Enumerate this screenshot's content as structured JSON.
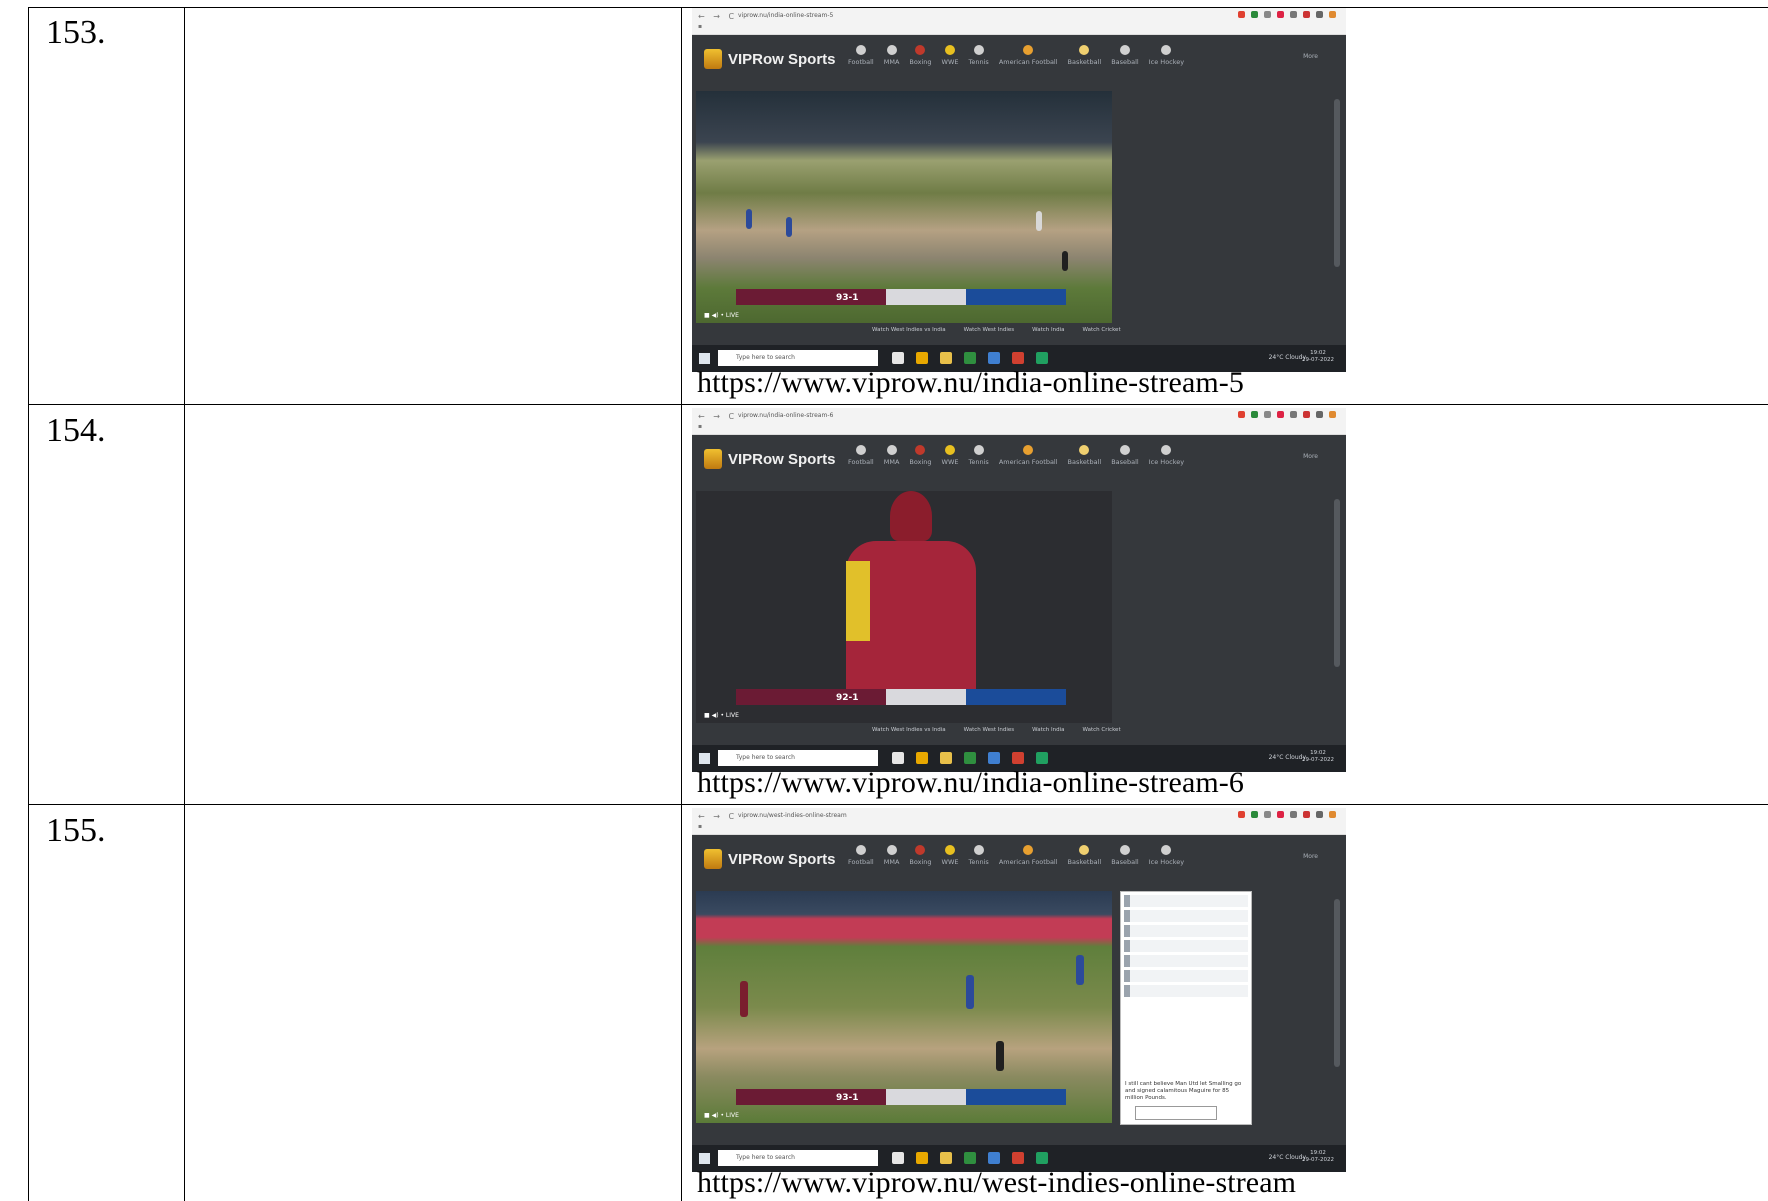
{
  "rows": [
    {
      "number": "153.",
      "url": "https://www.viprow.nu/india-online-stream-5",
      "screenshot": {
        "address": "viprow.nu/india-online-stream-5",
        "brand": "VIPRow Sports",
        "menu": [
          "Football",
          "MMA",
          "Boxing",
          "WWE",
          "Tennis",
          "American Football",
          "Basketball",
          "Baseball",
          "Ice Hockey"
        ],
        "more": "More",
        "bottom_links": [
          "Watch West Indies vs India",
          "Watch West Indies",
          "Watch India",
          "Watch Cricket"
        ],
        "search_placeholder": "Type here to search",
        "weather": "24°C Cloudy",
        "clock": [
          "19:02",
          "29-07-2022"
        ],
        "score": "93-1"
      }
    },
    {
      "number": "154.",
      "url": "https://www.viprow.nu/india-online-stream-6",
      "screenshot": {
        "address": "viprow.nu/india-online-stream-6",
        "brand": "VIPRow Sports",
        "menu": [
          "Football",
          "MMA",
          "Boxing",
          "WWE",
          "Tennis",
          "American Football",
          "Basketball",
          "Baseball",
          "Ice Hockey"
        ],
        "more": "More",
        "bottom_links": [
          "Watch West Indies vs India",
          "Watch West Indies",
          "Watch India",
          "Watch Cricket"
        ],
        "search_placeholder": "Type here to search",
        "weather": "24°C Cloudy",
        "clock": [
          "19:02",
          "29-07-2022"
        ],
        "score": "92-1"
      }
    },
    {
      "number": "155.",
      "url": "https://www.viprow.nu/west-indies-online-stream",
      "screenshot": {
        "address": "viprow.nu/west-indies-online-stream",
        "brand": "VIPRow Sports",
        "menu": [
          "Football",
          "MMA",
          "Boxing",
          "WWE",
          "Tennis",
          "American Football",
          "Basketball",
          "Baseball",
          "Ice Hockey"
        ],
        "more": "More",
        "chat_message": "I still cant believe Man Utd let Smalling go and signed calamitous Maguire for 85 million Pounds.",
        "search_placeholder": "Type here to search",
        "weather": "24°C Cloudy",
        "clock": [
          "19:02",
          "29-07-2022"
        ],
        "score": "93-1"
      }
    }
  ]
}
